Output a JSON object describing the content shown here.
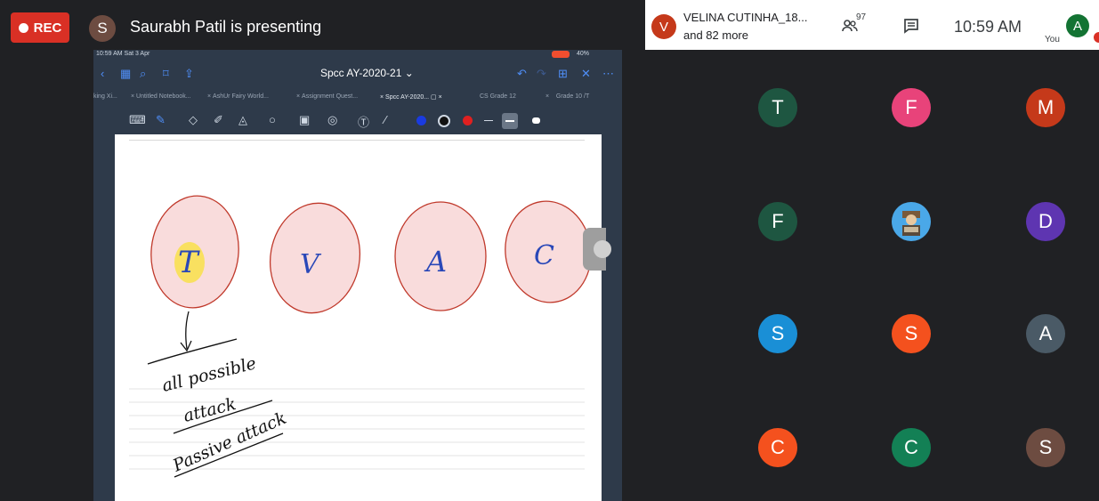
{
  "top_bar": {
    "rec_label": "REC",
    "presenter_initial": "S",
    "presenter_text": "Saurabh Patil is presenting"
  },
  "info_strip": {
    "participant_initial": "V",
    "participant_name": "VELINA CUTINHA_18...",
    "more_text": "and 82 more",
    "people_count": "97",
    "time": "10:59 AM",
    "you_label": "You",
    "you_initial": "A"
  },
  "ipad": {
    "status_time": "10:59 AM  Sat 3 Apr",
    "battery": "40%",
    "doc_title": "Spcc AY-2020-21",
    "tabs": [
      "king Xi...",
      "Untitled Notebook...",
      "AshUr Fairy World...",
      "Assignment Quest...",
      "Spcc AY-2020...",
      "CS Grade 12",
      "Grade 10 /T"
    ]
  },
  "notes": {
    "circle_letters": [
      "T",
      "V",
      "A",
      "C"
    ],
    "line1": "all possible",
    "line2": "attack",
    "line3": "Passive attack"
  },
  "participants": [
    {
      "initial": "T",
      "color": "#1e5641"
    },
    {
      "initial": "F",
      "color": "#e8437a"
    },
    {
      "initial": "M",
      "color": "#c5391a"
    },
    {
      "initial": "F",
      "color": "#1e5641"
    },
    {
      "initial": "",
      "color": "#4aa8e8"
    },
    {
      "initial": "D",
      "color": "#5e35b1"
    },
    {
      "initial": "S",
      "color": "#1a8fd6"
    },
    {
      "initial": "S",
      "color": "#f4511e"
    },
    {
      "initial": "A",
      "color": "#4a5a66"
    },
    {
      "initial": "C",
      "color": "#f4511e"
    },
    {
      "initial": "C",
      "color": "#138055"
    },
    {
      "initial": "S",
      "color": "#6d4c41"
    }
  ],
  "colors": {
    "background": "#202124",
    "rec": "#d93025",
    "circle_fill": "#f9dcdc",
    "circle_stroke": "#c0392b",
    "ink": "#2a48b8",
    "highlight": "#f9e04a"
  }
}
